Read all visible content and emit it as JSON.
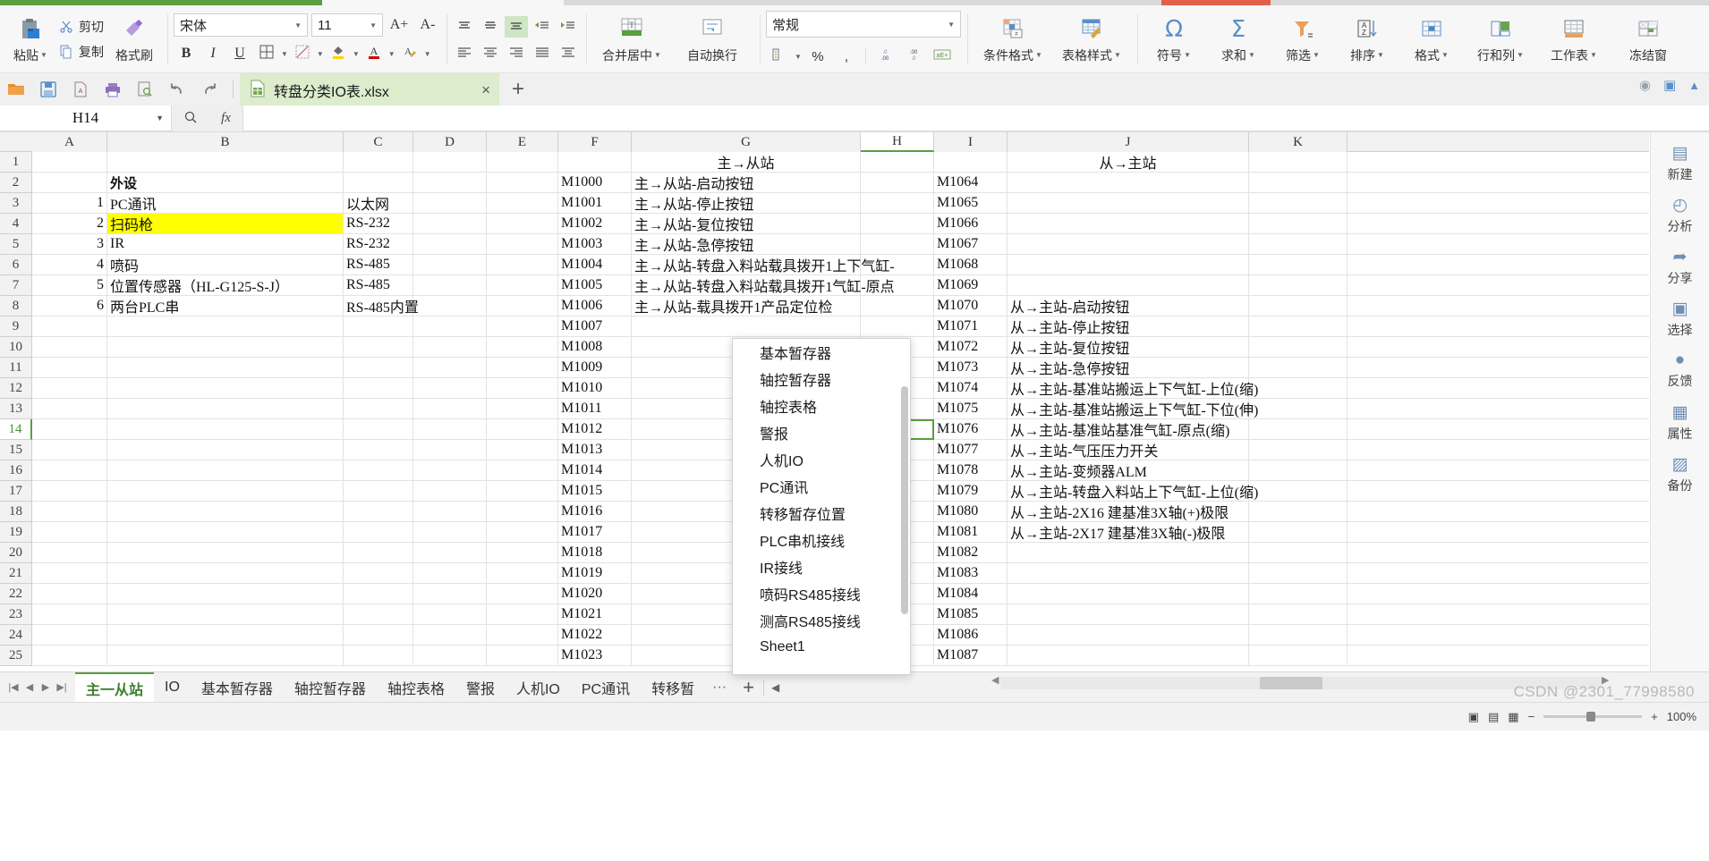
{
  "app": {
    "title": "WPS 表格",
    "document_tab": "转盘分类IO表.xlsx",
    "new_tab_label": "+"
  },
  "quick_access": {
    "icons": [
      "open-folder-icon",
      "save-icon",
      "export-pdf-icon",
      "print-icon",
      "print-preview-icon",
      "undo-icon",
      "redo-icon",
      "customize-qat-icon"
    ]
  },
  "ribbon": {
    "clipboard": {
      "paste": "粘贴",
      "cut": "剪切",
      "copy": "复制",
      "format_painter": "格式刷"
    },
    "font": {
      "family": "宋体",
      "size": "11",
      "grow": "A+",
      "shrink": "A-",
      "bold": "B",
      "italic": "I",
      "underline": "U",
      "borders": "田",
      "borders2": "框线",
      "fill_color": "填充颜色",
      "font_color": "A"
    },
    "alignment": {
      "merge_center": "合并居中",
      "wrap_text": "自动换行"
    },
    "number": {
      "format": "常规",
      "accounting": "会计数字格式",
      "percent": "%",
      "comma": ",",
      "inc_decimal": ".00",
      "dec_decimal": ".0",
      "currency": "aE+"
    },
    "styles": {
      "conditional_format": "条件格式",
      "table_style": "表格样式"
    },
    "editing": [
      {
        "label": "符号",
        "icon": "omega-icon"
      },
      {
        "label": "求和",
        "icon": "sigma-icon"
      },
      {
        "label": "筛选",
        "icon": "filter-icon"
      },
      {
        "label": "排序",
        "icon": "sort-az-icon"
      },
      {
        "label": "格式",
        "icon": "table-format-icon"
      },
      {
        "label": "行和列",
        "icon": "rows-cols-icon"
      },
      {
        "label": "工作表",
        "icon": "worksheet-icon"
      },
      {
        "label": "冻结窗",
        "icon": "freeze-panes-icon"
      }
    ]
  },
  "formula_bar": {
    "name_box": "H14",
    "search_icon": "search-icon",
    "fx_icon": "fx-icon",
    "formula_value": ""
  },
  "grid": {
    "columns": [
      "A",
      "B",
      "C",
      "D",
      "E",
      "F",
      "G",
      "H",
      "I",
      "J",
      "K"
    ],
    "selected_column": "H",
    "selected_row": "14",
    "selected_cell": "H14",
    "row_numbers": [
      "1",
      "2",
      "3",
      "4",
      "5",
      "6",
      "7",
      "8",
      "9",
      "10",
      "11",
      "12",
      "13",
      "14",
      "15",
      "16",
      "17",
      "18",
      "19",
      "20",
      "21",
      "22",
      "23",
      "24",
      "25"
    ],
    "rows": [
      {
        "n": "1",
        "B": "",
        "A": "",
        "C": "",
        "F": "",
        "G": "主→从站",
        "I": "",
        "J": "从→主站"
      },
      {
        "n": "2",
        "A": "",
        "B": "外设",
        "C": "",
        "F": "M1000",
        "G": "主→从站-启动按钮",
        "I": "M1064",
        "J": ""
      },
      {
        "n": "3",
        "A": "1",
        "B": "PC通讯",
        "C": "以太网",
        "F": "M1001",
        "G": "主→从站-停止按钮",
        "I": "M1065",
        "J": ""
      },
      {
        "n": "4",
        "A": "2",
        "B": "扫码枪",
        "C": "RS-232",
        "F": "M1002",
        "G": "主→从站-复位按钮",
        "I": "M1066",
        "J": ""
      },
      {
        "n": "5",
        "A": "3",
        "B": "IR",
        "C": "RS-232",
        "F": "M1003",
        "G": "主→从站-急停按钮",
        "I": "M1067",
        "J": ""
      },
      {
        "n": "6",
        "A": "4",
        "B": "喷码",
        "C": "RS-485",
        "F": "M1004",
        "G": "主→从站-转盘入料站载具拨开1上下气缸-",
        "I": "M1068",
        "J": ""
      },
      {
        "n": "7",
        "A": "5",
        "B": "位置传感器（HL-G125-S-J）",
        "C": "RS-485",
        "F": "M1005",
        "G": "主→从站-转盘入料站载具拨开1气缸-原点",
        "I": "M1069",
        "J": ""
      },
      {
        "n": "8",
        "A": "6",
        "B": "两台PLC串",
        "C": "RS-485内置",
        "F": "M1006",
        "G": "主→从站-载具拨开1产品定位检",
        "I": "M1070",
        "J": "从→主站-启动按钮"
      },
      {
        "n": "9",
        "A": "",
        "B": "",
        "C": "",
        "F": "M1007",
        "G": "",
        "I": "M1071",
        "J": "从→主站-停止按钮"
      },
      {
        "n": "10",
        "A": "",
        "B": "",
        "C": "",
        "F": "M1008",
        "G": "",
        "I": "M1072",
        "J": "从→主站-复位按钮"
      },
      {
        "n": "11",
        "A": "",
        "B": "",
        "C": "",
        "F": "M1009",
        "G": "",
        "I": "M1073",
        "J": "从→主站-急停按钮"
      },
      {
        "n": "12",
        "A": "",
        "B": "",
        "C": "",
        "F": "M1010",
        "G": "",
        "I": "M1074",
        "J": "从→主站-基准站搬运上下气缸-上位(缩)"
      },
      {
        "n": "13",
        "A": "",
        "B": "",
        "C": "",
        "F": "M1011",
        "G": "",
        "I": "M1075",
        "J": "从→主站-基准站搬运上下气缸-下位(伸)"
      },
      {
        "n": "14",
        "A": "",
        "B": "",
        "C": "",
        "F": "M1012",
        "G": "",
        "I": "M1076",
        "J": "从→主站-基准站基准气缸-原点(缩)"
      },
      {
        "n": "15",
        "A": "",
        "B": "",
        "C": "",
        "F": "M1013",
        "G": "",
        "I": "M1077",
        "J": "从→主站-气压压力开关"
      },
      {
        "n": "16",
        "A": "",
        "B": "",
        "C": "",
        "F": "M1014",
        "G": "",
        "I": "M1078",
        "J": "从→主站-变频器ALM"
      },
      {
        "n": "17",
        "A": "",
        "B": "",
        "C": "",
        "F": "M1015",
        "G": "",
        "I": "M1079",
        "J": "从→主站-转盘入料站上下气缸-上位(缩)"
      },
      {
        "n": "18",
        "A": "",
        "B": "",
        "C": "",
        "F": "M1016",
        "G": "",
        "I": "M1080",
        "J": "从→主站-2X16  建基准3X轴(+)极限"
      },
      {
        "n": "19",
        "A": "",
        "B": "",
        "C": "",
        "F": "M1017",
        "G": "",
        "I": "M1081",
        "J": "从→主站-2X17  建基准3X轴(-)极限"
      },
      {
        "n": "20",
        "A": "",
        "B": "",
        "C": "",
        "F": "M1018",
        "G": "",
        "I": "M1082",
        "J": ""
      },
      {
        "n": "21",
        "A": "",
        "B": "",
        "C": "",
        "F": "M1019",
        "G": "",
        "I": "M1083",
        "J": ""
      },
      {
        "n": "22",
        "A": "",
        "B": "",
        "C": "",
        "F": "M1020",
        "G": "",
        "I": "M1084",
        "J": ""
      },
      {
        "n": "23",
        "A": "",
        "B": "",
        "C": "",
        "F": "M1021",
        "G": "",
        "I": "M1085",
        "J": ""
      },
      {
        "n": "24",
        "A": "",
        "B": "",
        "C": "",
        "F": "M1022",
        "G": "",
        "I": "M1086",
        "J": ""
      },
      {
        "n": "25",
        "A": "",
        "B": "",
        "C": "",
        "F": "M1023",
        "G": "",
        "I": "M1087",
        "J": ""
      }
    ]
  },
  "sheet_popup": {
    "items": [
      "基本暂存器",
      "轴控暂存器",
      "轴控表格",
      "警报",
      "人机IO",
      "PC通讯",
      "转移暂存位置",
      "PLC串机接线",
      "IR接线",
      "喷码RS485接线",
      "测高RS485接线",
      "Sheet1"
    ]
  },
  "sheet_tabs": {
    "items": [
      {
        "label": "主一从站",
        "active": true
      },
      {
        "label": "IO",
        "active": false
      },
      {
        "label": "基本暂存器",
        "active": false
      },
      {
        "label": "轴控暂存器",
        "active": false
      },
      {
        "label": "轴控表格",
        "active": false
      },
      {
        "label": "警报",
        "active": false
      },
      {
        "label": "人机IO",
        "active": false
      },
      {
        "label": "PC通讯",
        "active": false
      },
      {
        "label": "转移暂",
        "active": false
      }
    ],
    "more": "···",
    "add": "+",
    "collapse": "◀"
  },
  "right_panel": {
    "items": [
      {
        "label": "新建",
        "icon": "new-doc-icon"
      },
      {
        "label": "分析",
        "icon": "analysis-icon"
      },
      {
        "label": "分享",
        "icon": "share-icon"
      },
      {
        "label": "选择",
        "icon": "select-icon"
      },
      {
        "label": "反馈",
        "icon": "feedback-icon"
      },
      {
        "label": "属性",
        "icon": "properties-icon"
      },
      {
        "label": "备份",
        "icon": "backup-icon"
      }
    ]
  },
  "status_bar": {
    "zoom": "100%",
    "minus": "−",
    "plus": "+"
  },
  "watermark": "CSDN @2301_77998580",
  "colors": {
    "accent_green": "#5a9e3f",
    "tab_green": "#dceccd",
    "highlight_yellow": "#ffff00",
    "red_strip": "#e2604a"
  }
}
